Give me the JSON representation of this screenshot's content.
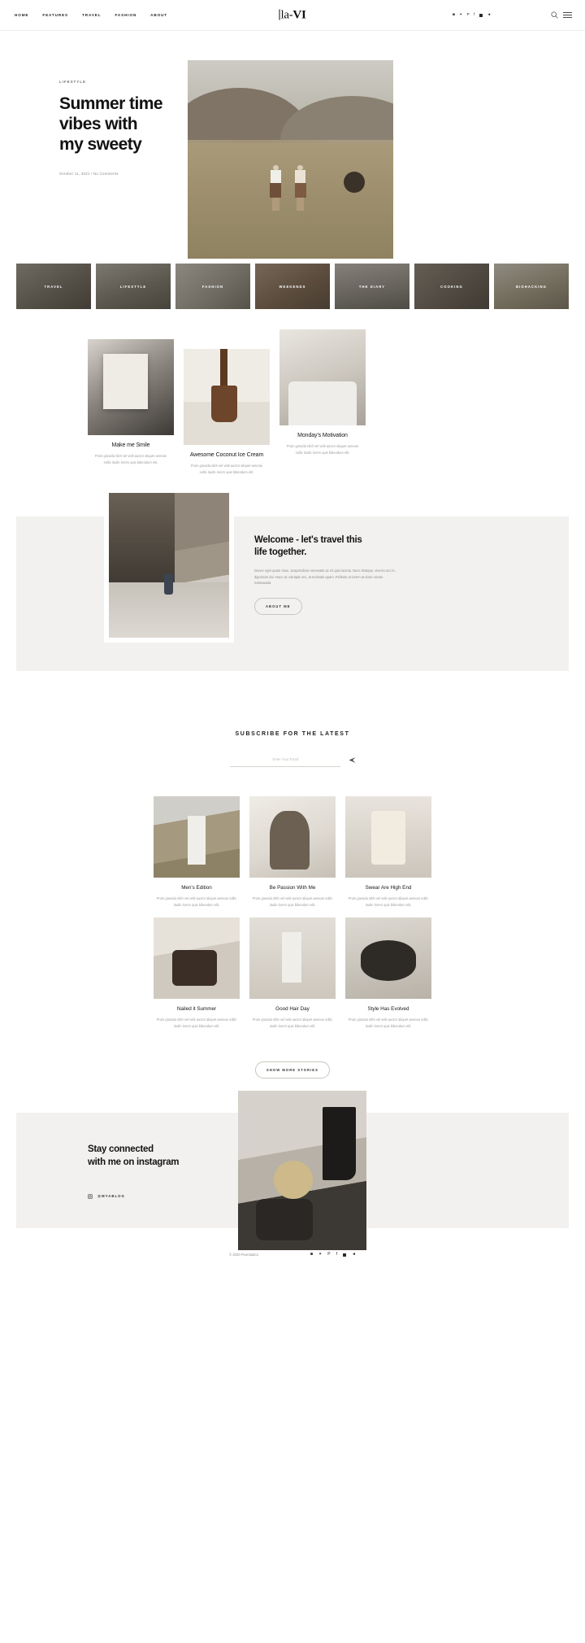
{
  "header": {
    "nav": [
      {
        "label": "HOME"
      },
      {
        "label": "FEATURES"
      },
      {
        "label": "TRAVEL"
      },
      {
        "label": "FASHION"
      },
      {
        "label": "ABOUT"
      }
    ],
    "logo": "la-VI",
    "logo_light": "la-",
    "logo_bold": "VI",
    "social": [
      "instagram-icon",
      "twitter-icon",
      "pinterest-icon",
      "facebook-icon",
      "tumblr-icon",
      "telegram-icon"
    ],
    "search_icon": "search-icon",
    "menu_icon": "hamburger-menu-icon"
  },
  "hero": {
    "kicker": "LIFESTYLE",
    "title_line1": "Summer time",
    "title_line2": "vibes with",
    "title_line3": "my sweety",
    "meta": "October 11, 2021 / No Comments"
  },
  "categories": [
    {
      "label": "TRAVEL"
    },
    {
      "label": "LIFESTYLE"
    },
    {
      "label": "FASHION"
    },
    {
      "label": "WEEKENDS"
    },
    {
      "label": "THE DIARY"
    },
    {
      "label": "COOKING"
    },
    {
      "label": "BIOHACKING"
    }
  ],
  "featured_posts": [
    {
      "title": "Make me Smile",
      "excerpt": "Proin gravida nibh vel velit auctor aliquet aenean sollic itudin lorem quis bibendum elit."
    },
    {
      "title": "Awesome Coconut Ice Cream",
      "excerpt": "Proin gravida nibh vel velit auctor aliquet aenean sollic itudin lorem quis bibendum elit."
    },
    {
      "title": "Monday's Motivation",
      "excerpt": "Proin gravida nibh vel velit auctor aliquet aenean sollic itudin lorem quis bibendum elit."
    }
  ],
  "welcome": {
    "heading_line1": "Welcome - let's travel this",
    "heading_line2": "life together.",
    "body": "Donec eget quam risus. Suspendisse venenatis ac mi quis lacinia. Nunc tristique, viverra orci in, dignissim dui. Nunc ac volutpat orci, at molestie quam. Pellente ut lorem at dolor ornare malesuada.",
    "button": "ABOUT ME"
  },
  "subscribe": {
    "title": "SUBSCRIBE FOR THE LATEST",
    "placeholder": "Enter Your Email",
    "value": "",
    "send_icon": "send-arrow-icon"
  },
  "grid_posts": [
    {
      "title": "Men's Edition",
      "excerpt": "Proin gravida nibh vel velit auctor aliquet aenean sollic itudin lorem quis bibendum elit."
    },
    {
      "title": "Be Passion With Me",
      "excerpt": "Proin gravida nibh vel velit auctor aliquet aenean sollic itudin lorem quis bibendum elit."
    },
    {
      "title": "Swear Are High End",
      "excerpt": "Proin gravida nibh vel velit auctor aliquet aenean sollic itudin lorem quis bibendum elit."
    },
    {
      "title": "Nailed it Summer",
      "excerpt": "Proin gravida nibh vel velit auctor aliquet aenean sollic itudin lorem quis bibendum elit."
    },
    {
      "title": "Good Hair Day",
      "excerpt": "Proin gravida nibh vel velit auctor aliquet aenean sollic itudin lorem quis bibendum elit."
    },
    {
      "title": "Style Has Evolved",
      "excerpt": "Proin gravida nibh vel velit auctor aliquet aenean sollic itudin lorem quis bibendum elit."
    }
  ],
  "show_more": "SHOW MORE STORIES",
  "instagram": {
    "heading_line1": "Stay connected",
    "heading_line2": "with me on instagram",
    "handle": "@MYABLOG",
    "icon": "instagram-icon"
  },
  "footer": {
    "copyright": "© 2020 Peonia&Co",
    "social": [
      "instagram-icon",
      "twitter-icon",
      "pinterest-icon",
      "facebook-icon",
      "tumblr-icon",
      "telegram-icon"
    ]
  },
  "colors": {
    "background": "#ffffff",
    "text": "#1a1a1a",
    "muted": "#9c9c9c",
    "band": "#f2f1ef",
    "border": "#ededed"
  }
}
